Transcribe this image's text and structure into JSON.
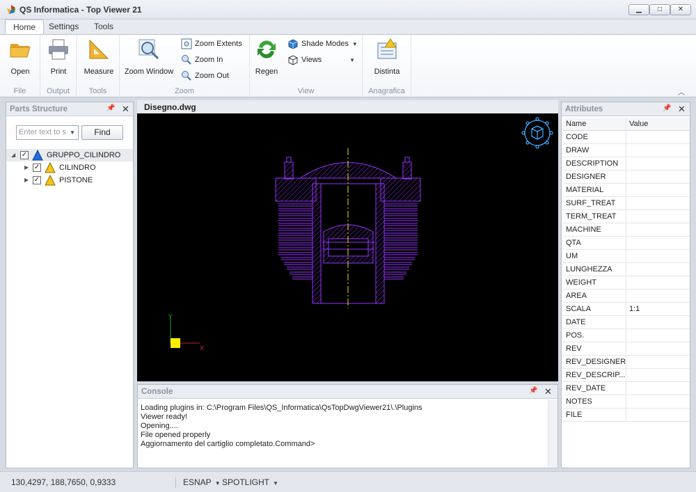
{
  "app": {
    "title": "QS Informatica - Top Viewer 21",
    "window_controls": [
      "minimize",
      "maximize",
      "close"
    ]
  },
  "ribbon": {
    "tabs": [
      {
        "label": "Home",
        "active": true
      },
      {
        "label": "Settings",
        "active": false
      },
      {
        "label": "Tools",
        "active": false
      }
    ],
    "groups": {
      "file": {
        "caption": "File",
        "open": "Open"
      },
      "output": {
        "caption": "Output",
        "print": "Print"
      },
      "tools": {
        "caption": "Tools",
        "measure": "Measure"
      },
      "zoom": {
        "caption": "Zoom",
        "zoom_window": "Zoom Window",
        "zoom_extents": "Zoom Extents",
        "zoom_in": "Zoom In",
        "zoom_out": "Zoom Out"
      },
      "view": {
        "caption": "View",
        "regen": "Regen",
        "shade_modes": "Shade Modes",
        "views": "Views"
      },
      "anagrafica": {
        "caption": "Anagrafica",
        "distinta": "Distinta"
      }
    },
    "icons": [
      "folder-open-icon",
      "printer-icon",
      "ruler-icon",
      "magnifier-icon",
      "zoom-extents-icon",
      "zoom-in-icon",
      "zoom-out-icon",
      "regen-icon",
      "cube-icon",
      "views-icon",
      "bom-icon"
    ]
  },
  "parts_structure": {
    "title": "Parts Structure",
    "search_placeholder": "Enter text to s",
    "find_label": "Find",
    "tree": [
      {
        "label": "GRUPPO_CILINDRO",
        "checked": true,
        "icon": "blue-triangle-icon",
        "expanded": true
      },
      {
        "label": "CILINDRO",
        "checked": true,
        "icon": "yellow-triangle-icon",
        "expanded": false
      },
      {
        "label": "PISTONE",
        "checked": true,
        "icon": "yellow-triangle-icon",
        "expanded": false
      }
    ]
  },
  "document": {
    "tab_label": "Disegno.dwg",
    "background": "#000000",
    "drawing_color": "#9933ff",
    "axis_labels": {
      "x": "X",
      "y": "Y"
    }
  },
  "console": {
    "title": "Console",
    "lines": [
      "Loading plugins in: C:\\Program Files\\QS_Informatica\\QsTopDwgViewer21\\.\\Plugins",
      "Viewer ready!",
      "Opening....",
      "File opened properly",
      "Aggiornamento del cartiglio completato.Command>"
    ]
  },
  "attributes": {
    "title": "Attributes",
    "columns": [
      "Name",
      "Value"
    ],
    "rows": [
      {
        "name": "CODE",
        "value": ""
      },
      {
        "name": "DRAW",
        "value": ""
      },
      {
        "name": "DESCRIPTION",
        "value": ""
      },
      {
        "name": "DESIGNER",
        "value": ""
      },
      {
        "name": "MATERIAL",
        "value": ""
      },
      {
        "name": "SURF_TREAT",
        "value": ""
      },
      {
        "name": "TERM_TREAT",
        "value": ""
      },
      {
        "name": "MACHINE",
        "value": ""
      },
      {
        "name": "QTA",
        "value": ""
      },
      {
        "name": "UM",
        "value": ""
      },
      {
        "name": "LUNGHEZZA",
        "value": ""
      },
      {
        "name": "WEIGHT",
        "value": ""
      },
      {
        "name": "AREA",
        "value": ""
      },
      {
        "name": "SCALA",
        "value": "1:1"
      },
      {
        "name": "DATE",
        "value": ""
      },
      {
        "name": "POS.",
        "value": ""
      },
      {
        "name": "REV",
        "value": ""
      },
      {
        "name": "REV_DESIGNER",
        "value": ""
      },
      {
        "name": "REV_DESCRIP...",
        "value": ""
      },
      {
        "name": "REV_DATE",
        "value": ""
      },
      {
        "name": "NOTES",
        "value": ""
      },
      {
        "name": "FILE",
        "value": ""
      }
    ]
  },
  "statusbar": {
    "coords": "130,4297, 188,7650, 0,9333",
    "esnap": "ESNAP",
    "spotlight": "SPOTLIGHT"
  }
}
